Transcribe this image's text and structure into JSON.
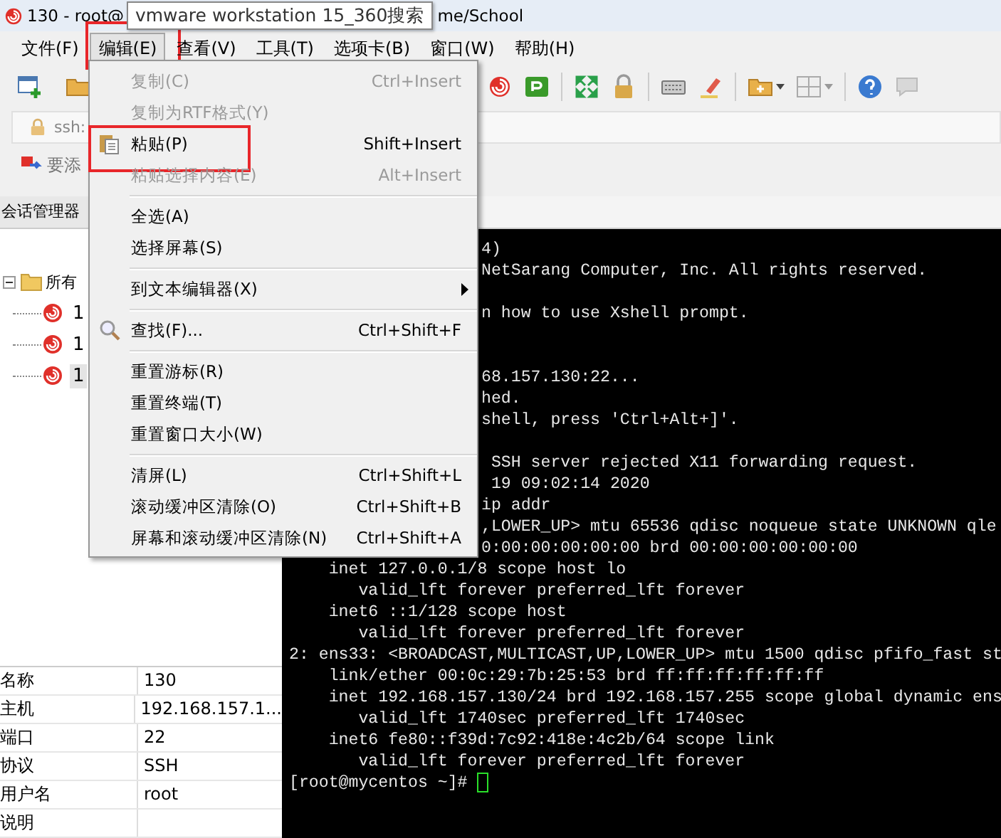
{
  "window": {
    "title_start": "130 - root@",
    "title_end": "me/School"
  },
  "tooltip": {
    "text": "vmware workstation 15_360搜索"
  },
  "menubar": [
    {
      "label": "文件(F)",
      "selected": false,
      "highlighted": false
    },
    {
      "label": "编辑(E)",
      "selected": true,
      "highlighted": true
    },
    {
      "label": "查看(V)",
      "selected": false,
      "highlighted": false
    },
    {
      "label": "工具(T)",
      "selected": false,
      "highlighted": false
    },
    {
      "label": "选项卡(B)",
      "selected": false,
      "highlighted": false
    },
    {
      "label": "窗口(W)",
      "selected": false,
      "highlighted": false
    },
    {
      "label": "帮助(H)",
      "selected": false,
      "highlighted": false
    }
  ],
  "address_bar": {
    "value": "ssh:"
  },
  "hint_bar": {
    "text": "要添"
  },
  "session_manager": {
    "title": "会话管理器",
    "tree": [
      {
        "label": "所有",
        "expanded": true,
        "selected": false,
        "children": [
          {
            "label": "1",
            "selected": false
          },
          {
            "label": "1",
            "selected": false
          },
          {
            "label": "1",
            "selected": true
          }
        ]
      }
    ],
    "properties": [
      {
        "name": "名称",
        "value": "130"
      },
      {
        "name": "主机",
        "value": "192.168.157.1..."
      },
      {
        "name": "端口",
        "value": "22"
      },
      {
        "name": "协议",
        "value": "SSH"
      },
      {
        "name": "用户名",
        "value": "root"
      },
      {
        "name": "说明"
      }
    ]
  },
  "edit_menu": [
    {
      "kind": "item",
      "label": "复制(C)",
      "shortcut": "Ctrl+Insert",
      "disabled": true,
      "highlighted": false
    },
    {
      "kind": "item",
      "label": "复制为RTF格式(Y)",
      "disabled": true,
      "highlighted": false
    },
    {
      "kind": "item",
      "label": "粘贴(P)",
      "shortcut": "Shift+Insert",
      "disabled": false,
      "highlighted": true
    },
    {
      "kind": "item",
      "label": "粘贴选择内容(E)",
      "shortcut": "Alt+Insert",
      "disabled": true,
      "highlighted": false
    },
    {
      "kind": "separator"
    },
    {
      "kind": "item",
      "label": "全选(A)",
      "disabled": false,
      "highlighted": false
    },
    {
      "kind": "item",
      "label": "选择屏幕(S)",
      "disabled": false,
      "highlighted": false
    },
    {
      "kind": "separator"
    },
    {
      "kind": "item",
      "label": "到文本编辑器(X)",
      "disabled": false,
      "highlighted": false,
      "submenu": true
    },
    {
      "kind": "separator"
    },
    {
      "kind": "item",
      "label": "查找(F)...",
      "shortcut": "Ctrl+Shift+F",
      "disabled": false,
      "highlighted": false
    },
    {
      "kind": "separator"
    },
    {
      "kind": "item",
      "label": "重置游标(R)",
      "disabled": false,
      "highlighted": false
    },
    {
      "kind": "item",
      "label": "重置终端(T)",
      "disabled": false,
      "highlighted": false
    },
    {
      "kind": "item",
      "label": "重置窗口大小(W)",
      "disabled": false,
      "highlighted": false
    },
    {
      "kind": "separator"
    },
    {
      "kind": "item",
      "label": "清屏(L)",
      "shortcut": "Ctrl+Shift+L",
      "disabled": false,
      "highlighted": false
    },
    {
      "kind": "item",
      "label": "滚动缓冲区清除(O)",
      "shortcut": "Ctrl+Shift+B",
      "disabled": false,
      "highlighted": false
    },
    {
      "kind": "item",
      "label": "屏幕和滚动缓冲区清除(N)",
      "shortcut": "Ctrl+Shift+A",
      "disabled": false,
      "highlighted": false
    }
  ],
  "terminal": {
    "blocks_beside_menu": [
      [
        "4)",
        "NetSarang Computer, Inc. All rights reserved."
      ],
      [
        "n how to use Xshell prompt."
      ],
      [
        "68.157.130:22...",
        "hed.",
        "shell, press 'Ctrl+Alt+]'."
      ],
      [
        " SSH server rejected X11 forwarding request.",
        " 19 09:02:14 2020",
        "ip addr",
        ",LOWER_UP> mtu 65536 qdisc noqueue state UNKNOWN qle",
        "0:00:00:00:00:00 brd 00:00:00:00:00:00"
      ]
    ],
    "lines": [
      "    inet 127.0.0.1/8 scope host lo",
      "       valid_lft forever preferred_lft forever",
      "    inet6 ::1/128 scope host",
      "       valid_lft forever preferred_lft forever",
      "2: ens33: <BROADCAST,MULTICAST,UP,LOWER_UP> mtu 1500 qdisc pfifo_fast st",
      "    link/ether 00:0c:29:7b:25:53 brd ff:ff:ff:ff:ff:ff",
      "    inet 192.168.157.130/24 brd 192.168.157.255 scope global dynamic ens",
      "       valid_lft 1740sec preferred_lft 1740sec",
      "    inet6 fe80::f39d:7c92:418e:4c2b/64 scope link",
      "       valid_lft forever preferred_lft forever"
    ],
    "prompt": "[root@mycentos ~]#",
    "cursor": true
  }
}
